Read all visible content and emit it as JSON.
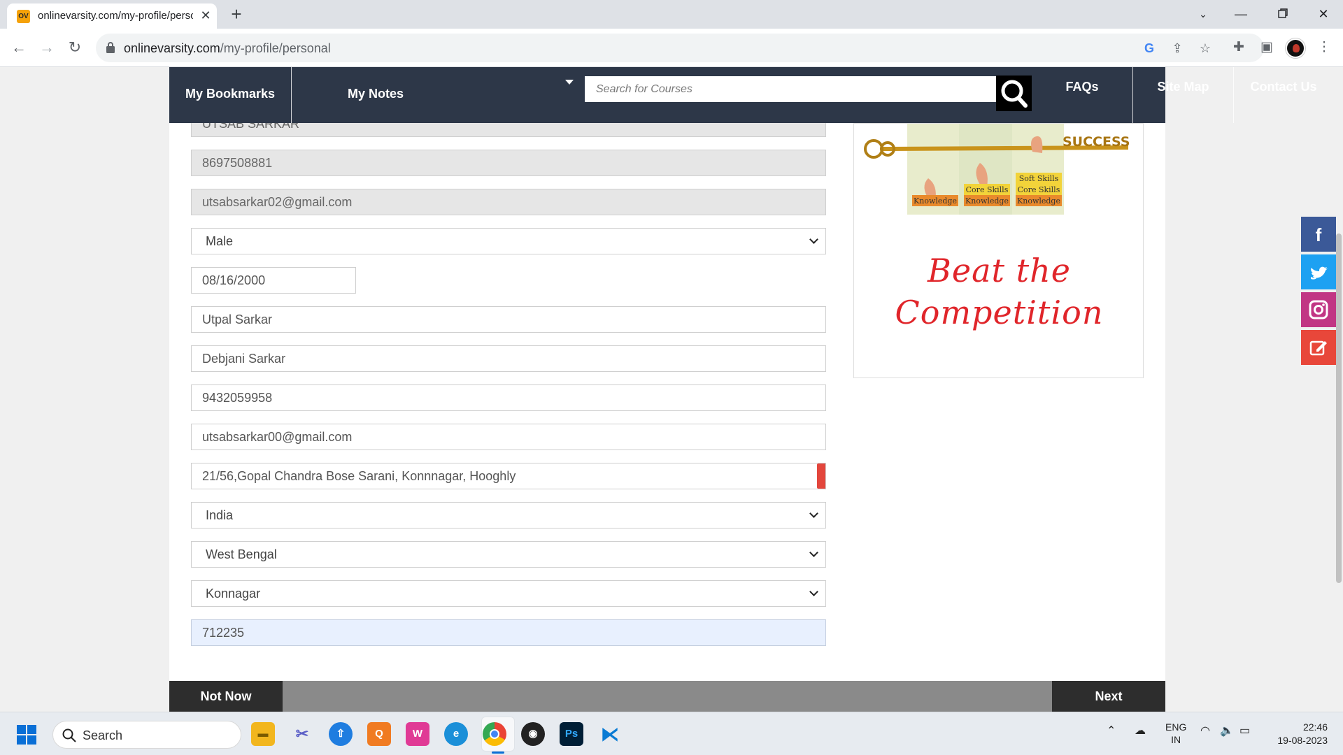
{
  "browser": {
    "tab_title": "onlinevarsity.com/my-profile/personal",
    "favicon_text": "OV",
    "url_host": "onlinevarsity.com",
    "url_path": "/my-profile/personal"
  },
  "site_nav": {
    "bookmarks": "My Bookmarks",
    "notes": "My Notes",
    "search_placeholder": "Search for Courses",
    "faqs": "FAQs",
    "sitemap": "Site Map",
    "contact": "Contact Us"
  },
  "form": {
    "name": "UTSAB SARKAR",
    "phone": "8697508881",
    "email": "utsabsarkar02@gmail.com",
    "gender": "Male",
    "dob": "08/16/2000",
    "father_name": "Utpal Sarkar",
    "mother_name": "Debjani Sarkar",
    "parent_phone": "9432059958",
    "alt_email": "utsabsarkar00@gmail.com",
    "address": "21/56,Gopal Chandra Bose Sarani, Konnnagar, Hooghly",
    "country": "India",
    "state": "West Bengal",
    "city": "Konnagar",
    "pincode": "712235"
  },
  "ad": {
    "success": "SUCCESS",
    "step1": "Knowledge",
    "step2": "Core Skills",
    "step3": "Soft Skills",
    "line1": "Beat the",
    "line2": "Competition"
  },
  "footer": {
    "not_now": "Not Now",
    "next": "Next"
  },
  "taskbar": {
    "search": "Search",
    "lang_1": "ENG",
    "lang_2": "IN",
    "time": "22:46",
    "date": "19-08-2023"
  },
  "colors": {
    "nav_bg": "#2d3748",
    "ad_red": "#e0252a",
    "facebook": "#3b5998",
    "twitter": "#1da1f2",
    "instagram": "#c13584",
    "edit": "#e8473a"
  }
}
